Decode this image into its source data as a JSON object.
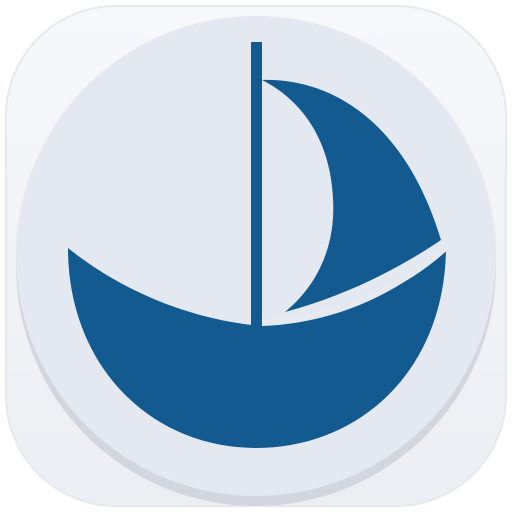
{
  "icon": {
    "name": "sailboat-icon",
    "colors": {
      "background_tile": "#f2f3f7",
      "tile_border": "#e6e8ee",
      "disc": "#e4e8f0",
      "disc_shadow": "#d2d6de",
      "boat": "#125a8f"
    }
  }
}
